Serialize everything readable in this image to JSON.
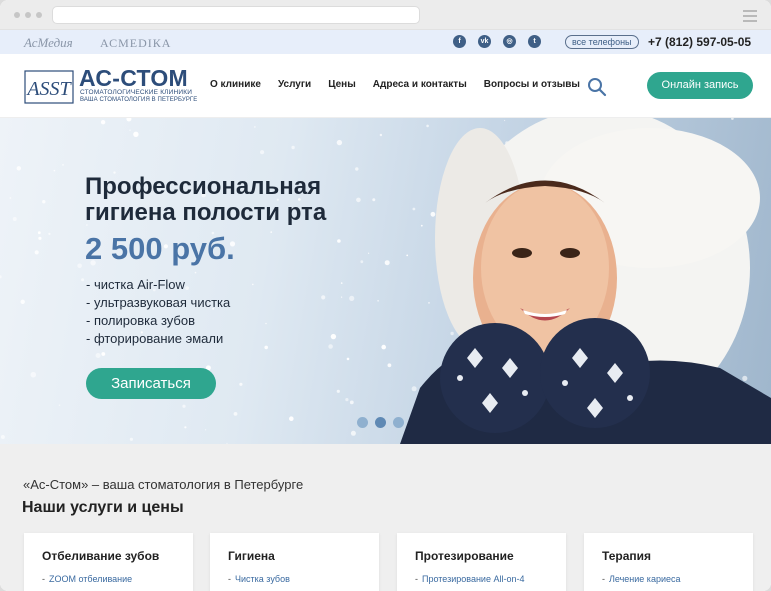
{
  "topbar": {
    "brand1": "АсМедия",
    "brand2": "АСМЕDIКА",
    "socials": [
      {
        "icon": "facebook-icon",
        "glyph": "f"
      },
      {
        "icon": "vk-icon",
        "glyph": "vk"
      },
      {
        "icon": "instagram-icon",
        "glyph": "◎"
      },
      {
        "icon": "twitter-icon",
        "glyph": "t"
      }
    ],
    "all_phones": "все телефоны",
    "phone": "+7 (812) 597-05-05"
  },
  "header": {
    "logo_mark": "ASST",
    "logo_name": "АС-СТОМ",
    "logo_sub1": "стоматологические клиники",
    "logo_sub2": "ваша стоматология в петербурге",
    "nav": [
      "О клинике",
      "Услуги",
      "Цены",
      "Адреса и контакты",
      "Вопросы и отзывы"
    ],
    "online_button": "Онлайн запись"
  },
  "hero": {
    "title_line1": "Профессиональная",
    "title_line2": "гигиена полости рта",
    "price": "2 500 руб.",
    "list": [
      "- чистка Air-Flow",
      "- ультразвуковая чистка",
      "- полировка зубов",
      "- фторирование эмали"
    ],
    "button": "Записаться",
    "slides": 3,
    "active_slide": 2
  },
  "section": {
    "subtitle": "«Ас-Стом» – ваша стоматология в Петербурге",
    "title": "Наши услуги и цены",
    "cards": [
      {
        "title": "Отбеливание зубов",
        "link": "ZOOM отбеливание"
      },
      {
        "title": "Гигиена",
        "link": "Чистка зубов"
      },
      {
        "title": "Протезирование",
        "link": "Протезирование All-on-4"
      },
      {
        "title": "Терапия",
        "link": "Лечение кариеса"
      }
    ]
  },
  "colors": {
    "accent_green": "#2fa68f",
    "brand_blue": "#2d4d7a",
    "price_blue": "#4a74a6"
  }
}
